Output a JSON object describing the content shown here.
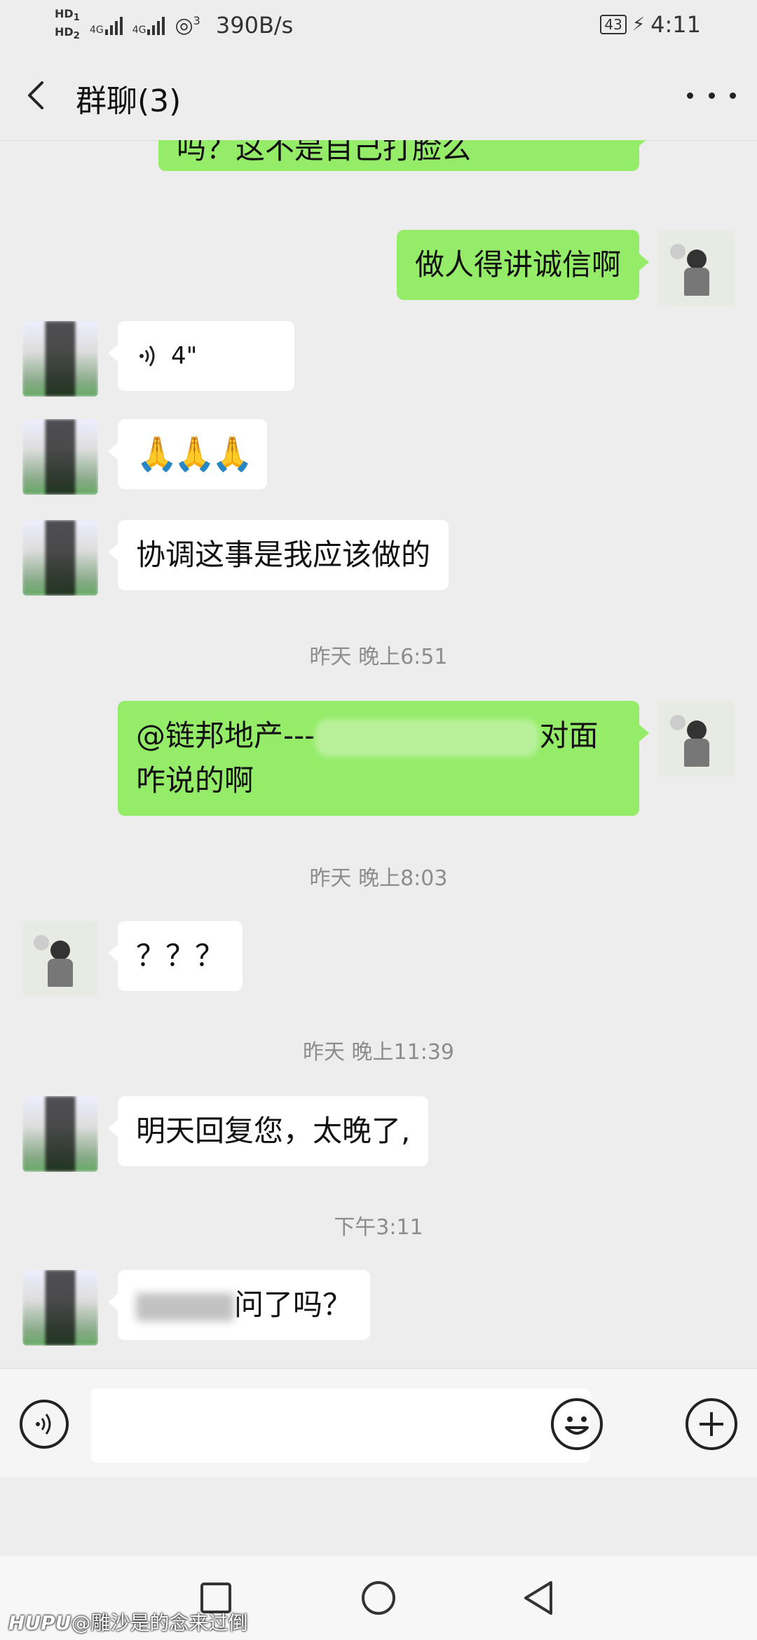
{
  "status_bar": {
    "hd1": "HD",
    "hd1_sub": "1",
    "hd2": "HD",
    "hd2_sub": "2",
    "sig1_label": "4G",
    "sig2_label": "4G",
    "hotspot_sup": "3",
    "net_speed": "390B/s",
    "battery": "43",
    "time": "4:11"
  },
  "header": {
    "title": "群聊(3)",
    "back_icon": "chevron-left-icon",
    "more_icon": "more-dots-icon"
  },
  "messages": [
    {
      "side": "out",
      "text": "吗？这不是自己打脸么"
    },
    {
      "side": "out",
      "text": "做人得讲诚信啊"
    },
    {
      "side": "in",
      "type": "voice",
      "duration": "4\""
    },
    {
      "side": "in",
      "text": "🙏🙏🙏"
    },
    {
      "side": "in",
      "text": "协调这事是我应该做的"
    },
    {
      "side": "out",
      "text_a": "@链邦地产---",
      "text_b": "对面",
      "text_c": "咋说的啊"
    },
    {
      "side": "in",
      "text": "？？？"
    },
    {
      "side": "in",
      "text": "明天回复您，太晚了,"
    },
    {
      "side": "in",
      "text": "问了吗？"
    }
  ],
  "timestamps": [
    "昨天 晚上6:51",
    "昨天 晚上8:03",
    "昨天 晚上11:39",
    "下午3:11"
  ],
  "input_bar": {
    "placeholder": "",
    "value": ""
  },
  "watermark": {
    "brand": "HUPU",
    "text": "@雕沙是的念来过倒"
  }
}
